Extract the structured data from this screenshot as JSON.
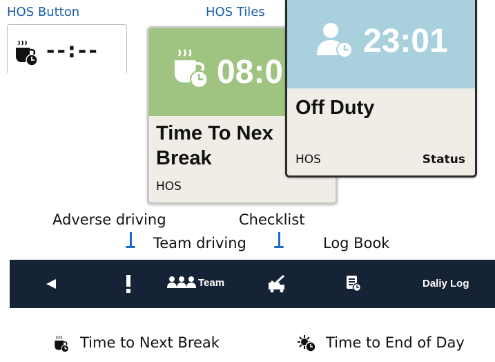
{
  "captions": {
    "hos_button": "HOS Button",
    "hos_tiles": "HOS Tiles"
  },
  "hos_button": {
    "value": "--:--",
    "icon": "coffee-cup-clock-icon"
  },
  "tiles": {
    "break_tile": {
      "value": "08:0",
      "title_line1": "Time To Nex",
      "title_line2": "Break",
      "footer_left": "HOS",
      "header_color": "#9fc481",
      "icon": "coffee-cup-clock-icon"
    },
    "status_tile": {
      "value": "23:01",
      "title": "Off Duty",
      "footer_left": "HOS",
      "footer_right": "Status",
      "header_color": "#a8d0dd",
      "icon": "person-clock-icon"
    }
  },
  "annotations": {
    "adverse_driving": "Adverse driving",
    "team_driving": "Team driving",
    "checklist": "Checklist",
    "log_book": "Log Book"
  },
  "navbar": {
    "background": "#162236",
    "back_icon": "back-triangle-icon",
    "adverse_icon": "exclamation-icon",
    "team_label": "Team",
    "team_icon": "team-people-icon",
    "checklist_icon": "checklist-truck-icon",
    "logbook_icon": "logbook-clock-icon",
    "daily_log_label": "Daliy Log"
  },
  "legend": {
    "next_break": "Time to Next Break",
    "end_of_day": "Time to End of Day"
  }
}
